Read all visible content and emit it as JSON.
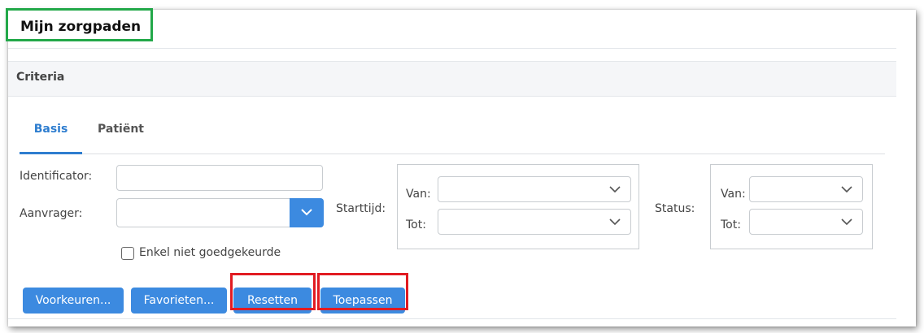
{
  "page": {
    "title": "Mijn zorgpaden"
  },
  "criteria": {
    "label": "Criteria"
  },
  "tabs": [
    {
      "label": "Basis",
      "active": true
    },
    {
      "label": "Patiënt",
      "active": false
    }
  ],
  "form": {
    "identificator_label": "Identificator:",
    "identificator_value": "",
    "aanvrager_label": "Aanvrager:",
    "aanvrager_value": "",
    "checkbox_label": "Enkel niet goedgekeurde",
    "checkbox_checked": false,
    "starttijd": {
      "label": "Starttijd:",
      "van_label": "Van:",
      "tot_label": "Tot:",
      "van_value": "",
      "tot_value": ""
    },
    "status": {
      "label": "Status:",
      "van_label": "Van:",
      "tot_label": "Tot:",
      "van_value": "",
      "tot_value": ""
    }
  },
  "buttons": {
    "voorkeuren": "Voorkeuren...",
    "favorieten": "Favorieten...",
    "resetten": "Resetten",
    "toepassen": "Toepassen"
  },
  "colors": {
    "accent": "#3c8ae0",
    "highlight_red": "#e11b22",
    "highlight_green": "#22a849"
  }
}
